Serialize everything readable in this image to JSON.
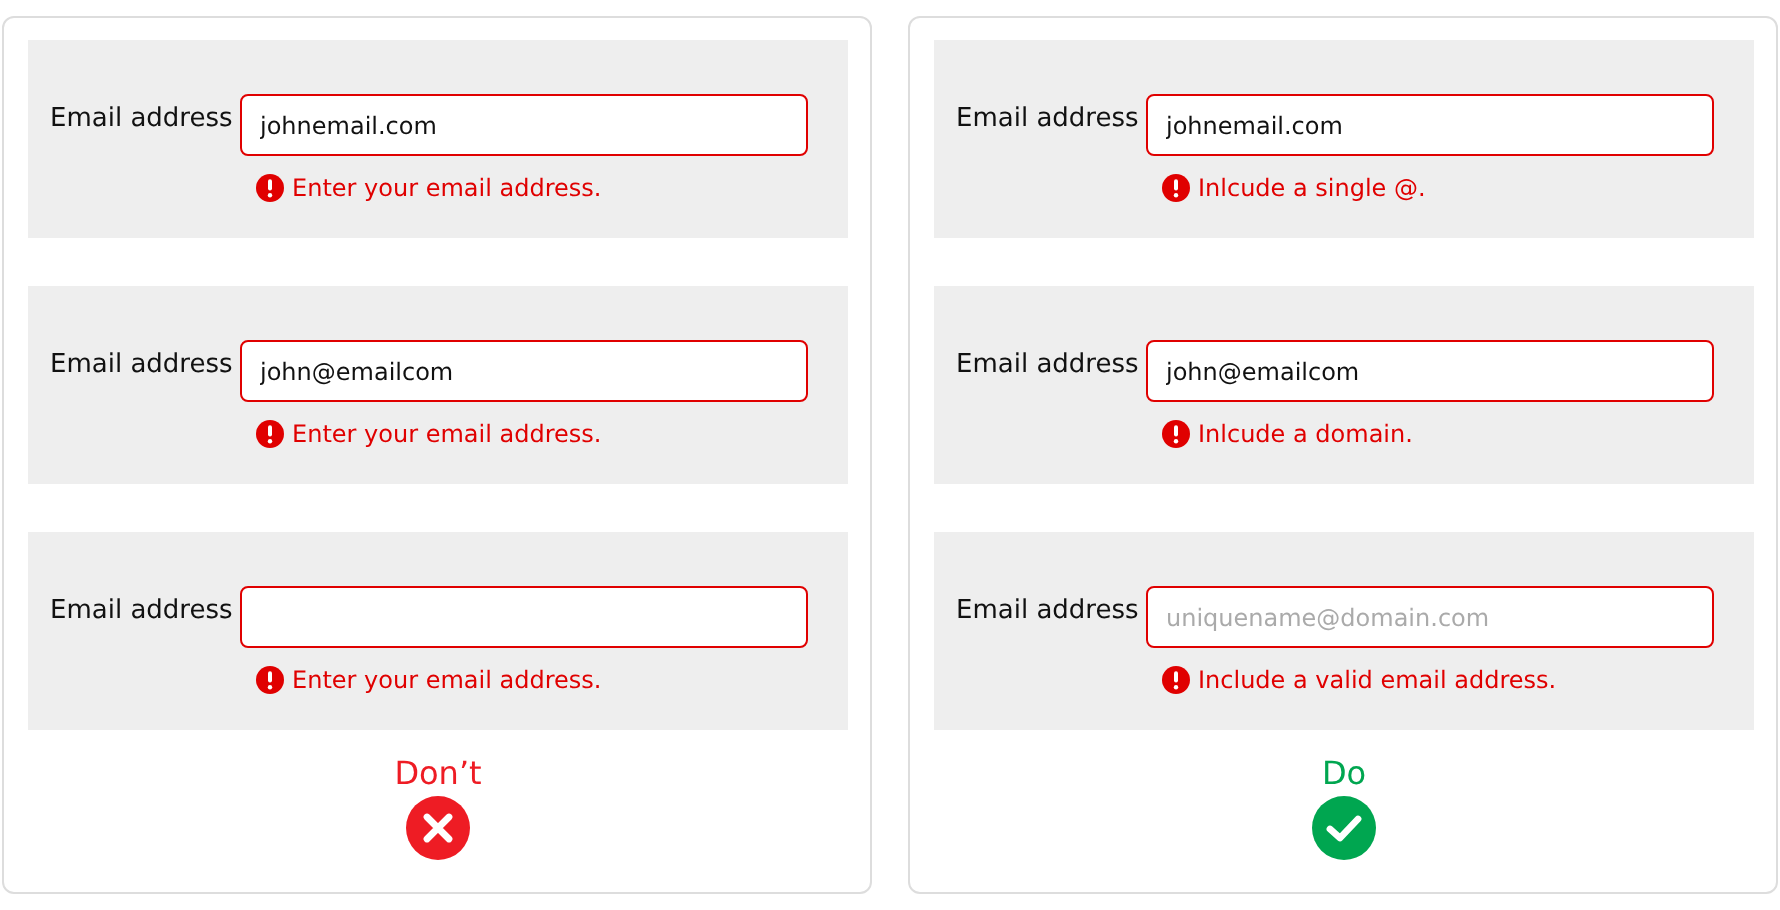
{
  "panels": [
    {
      "examples": [
        {
          "label": "Email address",
          "value": "johnemail.com",
          "error": "Enter your email address."
        },
        {
          "label": "Email address",
          "value": "john@emailcom",
          "error": "Enter your email address."
        },
        {
          "label": "Email address",
          "error": "Enter your email address."
        }
      ],
      "verdict": {
        "kind": "dont",
        "text": "Don’t"
      }
    },
    {
      "examples": [
        {
          "label": "Email address",
          "value": "johnemail.com",
          "error": "Inlcude a single @."
        },
        {
          "label": "Email address",
          "value": "john@emailcom",
          "error": "Inlcude a domain."
        },
        {
          "label": "Email address",
          "placeholder": "uniquename@domain.com",
          "error": "Include a valid email address."
        }
      ],
      "verdict": {
        "kind": "do",
        "text": "Do"
      }
    }
  ]
}
